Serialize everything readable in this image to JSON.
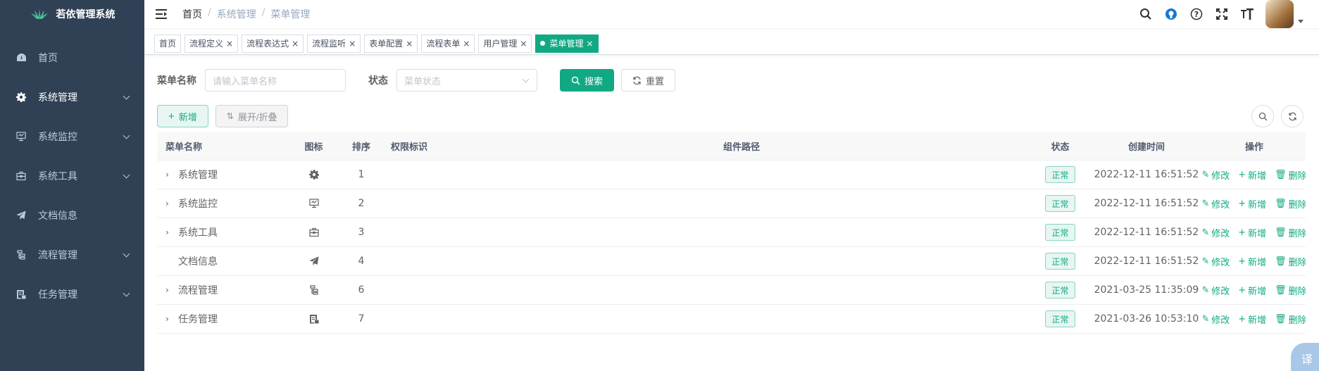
{
  "app": {
    "title": "若依管理系统"
  },
  "sidebar": {
    "items": [
      {
        "label": "首页",
        "icon": "dashboard-icon",
        "has_children": false,
        "active": false
      },
      {
        "label": "系统管理",
        "icon": "gear-icon",
        "has_children": true,
        "active": true
      },
      {
        "label": "系统监控",
        "icon": "monitor-icon",
        "has_children": true,
        "active": false
      },
      {
        "label": "系统工具",
        "icon": "toolbox-icon",
        "has_children": true,
        "active": false
      },
      {
        "label": "文档信息",
        "icon": "paper-plane-icon",
        "has_children": false,
        "active": false
      },
      {
        "label": "流程管理",
        "icon": "flow-icon",
        "has_children": true,
        "active": false
      },
      {
        "label": "任务管理",
        "icon": "task-icon",
        "has_children": true,
        "active": false
      }
    ]
  },
  "navbar": {
    "breadcrumb": [
      "首页",
      "系统管理",
      "菜单管理"
    ],
    "separator": "/",
    "icons": [
      "search-icon",
      "github-icon",
      "help-icon",
      "fullscreen-icon",
      "font-size-icon"
    ]
  },
  "tags": [
    {
      "label": "首页",
      "closable": false,
      "active": false
    },
    {
      "label": "流程定义",
      "closable": true,
      "active": false
    },
    {
      "label": "流程表达式",
      "closable": true,
      "active": false
    },
    {
      "label": "流程监听",
      "closable": true,
      "active": false
    },
    {
      "label": "表单配置",
      "closable": true,
      "active": false
    },
    {
      "label": "流程表单",
      "closable": true,
      "active": false
    },
    {
      "label": "用户管理",
      "closable": true,
      "active": false
    },
    {
      "label": "菜单管理",
      "closable": true,
      "active": true
    }
  ],
  "search": {
    "name_label": "菜单名称",
    "name_placeholder": "请输入菜单名称",
    "status_label": "状态",
    "status_placeholder": "菜单状态",
    "search_button": "搜索",
    "reset_button": "重置"
  },
  "toolbar": {
    "add_button": "新增",
    "expand_button": "展开/折叠"
  },
  "table": {
    "headers": [
      "菜单名称",
      "图标",
      "排序",
      "权限标识",
      "组件路径",
      "状态",
      "创建时间",
      "操作"
    ],
    "rows": [
      {
        "name": "系统管理",
        "icon": "gear-icon",
        "order": "1",
        "perm": "",
        "component": "",
        "status": "正常",
        "created": "2022-12-11 16:51:52",
        "expandable": true
      },
      {
        "name": "系统监控",
        "icon": "monitor-icon",
        "order": "2",
        "perm": "",
        "component": "",
        "status": "正常",
        "created": "2022-12-11 16:51:52",
        "expandable": true
      },
      {
        "name": "系统工具",
        "icon": "toolbox-icon",
        "order": "3",
        "perm": "",
        "component": "",
        "status": "正常",
        "created": "2022-12-11 16:51:52",
        "expandable": true
      },
      {
        "name": "文档信息",
        "icon": "paper-plane-icon",
        "order": "4",
        "perm": "",
        "component": "",
        "status": "正常",
        "created": "2022-12-11 16:51:52",
        "expandable": false
      },
      {
        "name": "流程管理",
        "icon": "flow-icon",
        "order": "6",
        "perm": "",
        "component": "",
        "status": "正常",
        "created": "2021-03-25 11:35:09",
        "expandable": true
      },
      {
        "name": "任务管理",
        "icon": "task-icon",
        "order": "7",
        "perm": "",
        "component": "",
        "status": "正常",
        "created": "2021-03-26 10:53:10",
        "expandable": true
      }
    ],
    "actions": {
      "edit": "修改",
      "add": "新增",
      "delete": "删除"
    }
  },
  "translate_badge": "译",
  "colors": {
    "primary": "#11a983",
    "sidebar_bg": "#304156",
    "sidebar_text": "#bfcbd9"
  }
}
